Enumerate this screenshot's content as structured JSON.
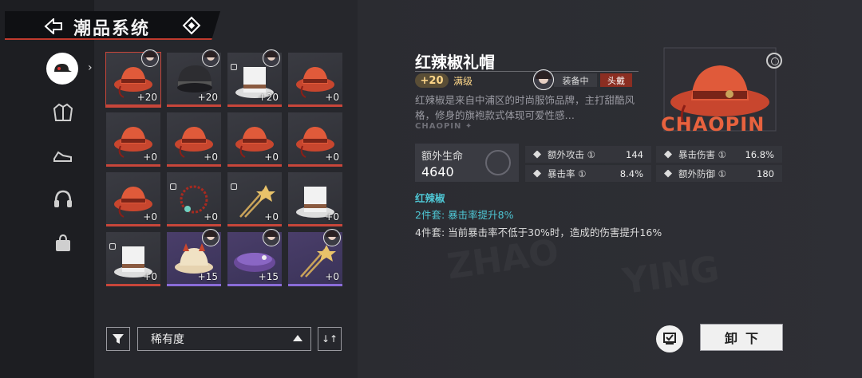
{
  "header": {
    "title": "潮品系统"
  },
  "nav": {
    "items": [
      {
        "name": "cap",
        "active": true
      },
      {
        "name": "jacket",
        "active": false
      },
      {
        "name": "shoes",
        "active": false
      },
      {
        "name": "headphones",
        "active": false
      },
      {
        "name": "bag",
        "active": false
      }
    ]
  },
  "grid": {
    "items": [
      {
        "kind": "red-hat",
        "level": "+20",
        "owner": true,
        "locked": false,
        "rarity": "red",
        "selected": true
      },
      {
        "kind": "black-helmet",
        "level": "+20",
        "owner": true,
        "locked": false,
        "rarity": "red"
      },
      {
        "kind": "white-top-hat",
        "level": "+20",
        "owner": true,
        "locked": true,
        "rarity": "red"
      },
      {
        "kind": "red-hat",
        "level": "+0",
        "owner": false,
        "locked": false,
        "rarity": "red"
      },
      {
        "kind": "red-hat",
        "level": "+0",
        "owner": false,
        "locked": false,
        "rarity": "red"
      },
      {
        "kind": "red-hat",
        "level": "+0",
        "owner": false,
        "locked": false,
        "rarity": "red"
      },
      {
        "kind": "red-hat",
        "level": "+0",
        "owner": false,
        "locked": false,
        "rarity": "red"
      },
      {
        "kind": "red-hat",
        "level": "+0",
        "owner": false,
        "locked": false,
        "rarity": "red"
      },
      {
        "kind": "red-hat",
        "level": "+0",
        "owner": false,
        "locked": false,
        "rarity": "red"
      },
      {
        "kind": "red-necklace",
        "level": "+0",
        "owner": false,
        "locked": true,
        "rarity": "red"
      },
      {
        "kind": "gold-hairpin",
        "level": "+0",
        "owner": false,
        "locked": true,
        "rarity": "red"
      },
      {
        "kind": "white-top-hat",
        "level": "+0",
        "owner": false,
        "locked": false,
        "rarity": "red"
      },
      {
        "kind": "white-top-hat",
        "level": "+0",
        "owner": false,
        "locked": true,
        "rarity": "red"
      },
      {
        "kind": "cat-cap",
        "level": "+15",
        "owner": true,
        "locked": false,
        "rarity": "purple"
      },
      {
        "kind": "purple-beret",
        "level": "+15",
        "owner": true,
        "locked": false,
        "rarity": "purple"
      },
      {
        "kind": "gold-hairpin",
        "level": "+0",
        "owner": true,
        "locked": false,
        "rarity": "purple"
      }
    ]
  },
  "controls": {
    "sort_label": "稀有度",
    "order_icon": "↓↑"
  },
  "detail": {
    "name": "红辣椒礼帽",
    "level": "+20",
    "max_label": "满级",
    "equipped_label": "装备中",
    "slot_label": "头戴",
    "description": "红辣椒是来自中浦区的时尚服饰品牌，主打甜酷风格，修身的旗袍款式体现可爱性感…",
    "brand_strip": "CHAOPIN ✦",
    "brand_logo": "CHAOPIN",
    "main_stat": {
      "label": "额外生命",
      "value": "4640"
    },
    "stats": [
      {
        "label": "额外攻击 ①",
        "value": "144"
      },
      {
        "label": "暴击伤害 ①",
        "value": "16.8%"
      },
      {
        "label": "暴击率 ①",
        "value": "8.4%"
      },
      {
        "label": "额外防御 ①",
        "value": "180"
      }
    ],
    "set": {
      "name": "红辣椒",
      "bonus2": "2件套: 暴击率提升8%",
      "bonus4": "4件套: 当前暴击率不低于30%时，造成的伤害提升16%"
    },
    "unequip_label": "卸下"
  },
  "colors": {
    "accent": "#c8463a",
    "set_active": "#4ec6d4",
    "gold": "#ffd88a"
  }
}
